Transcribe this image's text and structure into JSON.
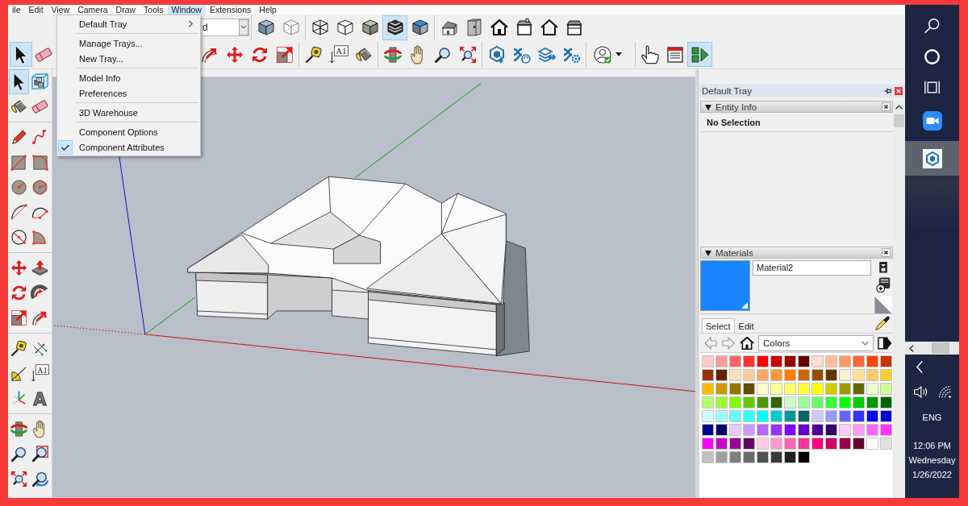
{
  "menu_bar": {
    "items": [
      {
        "label": "ile",
        "selected": false
      },
      {
        "label": "Edit",
        "selected": false
      },
      {
        "label": "View",
        "selected": false
      },
      {
        "label": "Camera",
        "selected": false
      },
      {
        "label": "Draw",
        "selected": false
      },
      {
        "label": "Tools",
        "selected": false
      },
      {
        "label": "Window",
        "selected": true
      },
      {
        "label": "Extensions",
        "selected": false
      },
      {
        "label": "Help",
        "selected": false
      }
    ]
  },
  "window_menu": {
    "groups": [
      [
        {
          "label": "Default Tray",
          "submenu": true,
          "checked": false
        }
      ],
      [
        {
          "label": "Manage Trays...",
          "submenu": false,
          "checked": false
        },
        {
          "label": "New Tray...",
          "submenu": false,
          "checked": false
        }
      ],
      [
        {
          "label": "Model Info",
          "submenu": false,
          "checked": false
        },
        {
          "label": "Preferences",
          "submenu": false,
          "checked": false
        }
      ],
      [
        {
          "label": "3D Warehouse",
          "submenu": false,
          "checked": false
        }
      ],
      [
        {
          "label": "Component Options",
          "submenu": false,
          "checked": false
        },
        {
          "label": "Component Attributes",
          "submenu": false,
          "checked": true
        }
      ]
    ]
  },
  "toolbar_top": {
    "dropdown": {
      "value": "d"
    },
    "groups": [
      [
        {
          "kind": "xray",
          "selected": false
        },
        {
          "kind": "back-edges",
          "selected": false
        }
      ],
      [
        {
          "kind": "wireframe",
          "selected": false
        },
        {
          "kind": "hidden-line",
          "selected": false
        },
        {
          "kind": "shaded",
          "selected": false
        },
        {
          "kind": "textured",
          "selected": true
        },
        {
          "kind": "monochrome",
          "selected": false
        }
      ],
      [
        {
          "kind": "house-iso",
          "selected": false
        },
        {
          "kind": "cabinet",
          "selected": false
        },
        {
          "kind": "house-front",
          "selected": false
        },
        {
          "kind": "house-chimney",
          "selected": false
        },
        {
          "kind": "house-outline",
          "selected": false
        },
        {
          "kind": "house-box",
          "selected": false
        }
      ]
    ]
  },
  "toolbar_main": {
    "groups": [
      [
        {
          "kind": "select",
          "selected": true
        },
        {
          "kind": "eraser",
          "selected": false
        }
      ],
      [
        {
          "kind": "offset",
          "selected": false
        },
        {
          "kind": "move",
          "selected": false
        },
        {
          "kind": "rotate",
          "selected": false
        },
        {
          "kind": "scale",
          "selected": false
        }
      ],
      [
        {
          "kind": "tape",
          "selected": false
        },
        {
          "kind": "text",
          "label": "A1",
          "selected": false
        },
        {
          "kind": "paint",
          "selected": false
        }
      ],
      [
        {
          "kind": "orbit",
          "selected": false
        },
        {
          "kind": "pan",
          "selected": false
        },
        {
          "kind": "zoom",
          "selected": false
        },
        {
          "kind": "zoom-extents",
          "selected": false
        }
      ],
      [
        {
          "kind": "warehouse",
          "selected": false
        },
        {
          "kind": "extension-warehouse",
          "selected": false
        },
        {
          "kind": "layout-send",
          "selected": false
        },
        {
          "kind": "extension-manager",
          "selected": false
        }
      ],
      [
        {
          "kind": "account",
          "selected": false
        }
      ],
      [
        {
          "kind": "pointing-hand",
          "selected": false
        },
        {
          "kind": "panel",
          "selected": false
        },
        {
          "kind": "play",
          "selected": true
        }
      ]
    ]
  },
  "left_toolbar": {
    "groups": [
      [
        {
          "kind": "select",
          "selected": true
        },
        {
          "kind": "component",
          "selected": false
        },
        {
          "kind": "paint",
          "selected": false
        },
        {
          "kind": "eraser",
          "selected": false
        }
      ],
      [
        {
          "kind": "pencil",
          "selected": false
        },
        {
          "kind": "freehand",
          "selected": false
        },
        {
          "kind": "rectangle",
          "selected": false
        },
        {
          "kind": "rotated-rectangle",
          "selected": false
        },
        {
          "kind": "circle",
          "selected": false
        },
        {
          "kind": "polygon",
          "selected": false
        },
        {
          "kind": "arc",
          "selected": false
        },
        {
          "kind": "arc-2pt",
          "selected": false
        },
        {
          "kind": "arc-3pt",
          "selected": false
        },
        {
          "kind": "pie",
          "selected": false
        }
      ],
      [
        {
          "kind": "move",
          "selected": false
        },
        {
          "kind": "push-pull",
          "selected": false
        },
        {
          "kind": "rotate",
          "selected": false
        },
        {
          "kind": "follow-me",
          "selected": false
        },
        {
          "kind": "scale",
          "selected": false
        },
        {
          "kind": "offset",
          "selected": false
        }
      ],
      [
        {
          "kind": "tape",
          "selected": false
        },
        {
          "kind": "dimension",
          "selected": false
        },
        {
          "kind": "protractor",
          "selected": false
        },
        {
          "kind": "text",
          "label": "A1",
          "selected": false
        },
        {
          "kind": "axes",
          "selected": false
        },
        {
          "kind": "text-3d",
          "label": "A",
          "selected": false
        }
      ],
      [
        {
          "kind": "orbit",
          "selected": false
        },
        {
          "kind": "pan",
          "selected": false
        },
        {
          "kind": "zoom",
          "selected": false
        },
        {
          "kind": "zoom-window",
          "selected": false
        },
        {
          "kind": "zoom-extents",
          "selected": false
        },
        {
          "kind": "previous",
          "selected": false
        }
      ]
    ]
  },
  "tray": {
    "title": "Default Tray"
  },
  "entity_info": {
    "title": "Entity Info",
    "expanded": true,
    "selection": "No Selection"
  },
  "materials": {
    "title": "Materials",
    "expanded": true,
    "current": {
      "name": "Material2",
      "color": "#1a84ff"
    },
    "tabs": [
      {
        "label": "Select",
        "selected": true
      },
      {
        "label": "Edit",
        "selected": false
      }
    ],
    "library": "Colors",
    "swatches": [
      {
        "color": "#ffcccc",
        "selected": false
      },
      {
        "color": "#ff9999",
        "selected": false
      },
      {
        "color": "#ff6666",
        "selected": false
      },
      {
        "color": "#ff3333",
        "selected": false
      },
      {
        "color": "#ff0000",
        "selected": false
      },
      {
        "color": "#cc0000",
        "selected": false
      },
      {
        "color": "#990000",
        "selected": false
      },
      {
        "color": "#660000",
        "selected": false
      },
      {
        "color": "#ffddcc",
        "selected": false
      },
      {
        "color": "#ffbb99",
        "selected": false
      },
      {
        "color": "#ff9966",
        "selected": false
      },
      {
        "color": "#ff6633",
        "selected": false
      },
      {
        "color": "#ff4400",
        "selected": false
      },
      {
        "color": "#cc3300",
        "selected": false
      },
      {
        "color": "#993300",
        "selected": false
      },
      {
        "color": "#662200",
        "selected": false
      },
      {
        "color": "#ffe0c0",
        "selected": false
      },
      {
        "color": "#ffcc99",
        "selected": false
      },
      {
        "color": "#ffaa66",
        "selected": false
      },
      {
        "color": "#ff9933",
        "selected": false
      },
      {
        "color": "#ff8000",
        "selected": false
      },
      {
        "color": "#cc6600",
        "selected": false
      },
      {
        "color": "#994c00",
        "selected": false
      },
      {
        "color": "#663300",
        "selected": false
      },
      {
        "color": "#fff0cc",
        "selected": false
      },
      {
        "color": "#ffe099",
        "selected": false
      },
      {
        "color": "#ffcc66",
        "selected": false
      },
      {
        "color": "#ffcc33",
        "selected": false
      },
      {
        "color": "#ffbb00",
        "selected": false
      },
      {
        "color": "#cc9900",
        "selected": false
      },
      {
        "color": "#997300",
        "selected": false
      },
      {
        "color": "#664d00",
        "selected": false
      },
      {
        "color": "#ffffcc",
        "selected": false
      },
      {
        "color": "#ffff99",
        "selected": false
      },
      {
        "color": "#ffff66",
        "selected": false
      },
      {
        "color": "#ffff33",
        "selected": false
      },
      {
        "color": "#ffff00",
        "selected": false
      },
      {
        "color": "#cccc00",
        "selected": false
      },
      {
        "color": "#999900",
        "selected": false
      },
      {
        "color": "#666600",
        "selected": false
      },
      {
        "color": "#eeffcc",
        "selected": false
      },
      {
        "color": "#ccff99",
        "selected": false
      },
      {
        "color": "#b3ff66",
        "selected": false
      },
      {
        "color": "#99ff33",
        "selected": false
      },
      {
        "color": "#80ff00",
        "selected": false
      },
      {
        "color": "#66cc00",
        "selected": false
      },
      {
        "color": "#4d9900",
        "selected": false
      },
      {
        "color": "#336600",
        "selected": false
      },
      {
        "color": "#ccffcc",
        "selected": false
      },
      {
        "color": "#99ff99",
        "selected": false
      },
      {
        "color": "#66ff66",
        "selected": false
      },
      {
        "color": "#33ff33",
        "selected": false
      },
      {
        "color": "#00ff00",
        "selected": false
      },
      {
        "color": "#00cc00",
        "selected": false
      },
      {
        "color": "#009900",
        "selected": false
      },
      {
        "color": "#006600",
        "selected": false
      },
      {
        "color": "#ccffff",
        "selected": false
      },
      {
        "color": "#99ffff",
        "selected": false
      },
      {
        "color": "#66ffff",
        "selected": false
      },
      {
        "color": "#33ffff",
        "selected": false
      },
      {
        "color": "#00ffff",
        "selected": false
      },
      {
        "color": "#00cccc",
        "selected": false
      },
      {
        "color": "#009999",
        "selected": false
      },
      {
        "color": "#006666",
        "selected": false
      },
      {
        "color": "#ccccff",
        "selected": false
      },
      {
        "color": "#9999ff",
        "selected": false
      },
      {
        "color": "#6666ff",
        "selected": false
      },
      {
        "color": "#3333ff",
        "selected": false
      },
      {
        "color": "#0000ff",
        "selected": false
      },
      {
        "color": "#0000cc",
        "selected": false
      },
      {
        "color": "#000099",
        "selected": false
      },
      {
        "color": "#000066",
        "selected": false
      },
      {
        "color": "#e5ccff",
        "selected": false
      },
      {
        "color": "#cc99ff",
        "selected": false
      },
      {
        "color": "#b266ff",
        "selected": false
      },
      {
        "color": "#9933ff",
        "selected": false
      },
      {
        "color": "#8000ff",
        "selected": false
      },
      {
        "color": "#6600cc",
        "selected": false
      },
      {
        "color": "#4c0099",
        "selected": false
      },
      {
        "color": "#330066",
        "selected": false
      },
      {
        "color": "#ffccff",
        "selected": false
      },
      {
        "color": "#ff99ff",
        "selected": false
      },
      {
        "color": "#ff66ff",
        "selected": false
      },
      {
        "color": "#ff33ff",
        "selected": false
      },
      {
        "color": "#ff00ff",
        "selected": false
      },
      {
        "color": "#cc00cc",
        "selected": false
      },
      {
        "color": "#990099",
        "selected": false
      },
      {
        "color": "#660066",
        "selected": false
      },
      {
        "color": "#ffcce5",
        "selected": false
      },
      {
        "color": "#ff99cc",
        "selected": false
      },
      {
        "color": "#ff66b2",
        "selected": false
      },
      {
        "color": "#ff3399",
        "selected": false
      },
      {
        "color": "#ff0080",
        "selected": false
      },
      {
        "color": "#cc0066",
        "selected": false
      },
      {
        "color": "#99004c",
        "selected": false
      },
      {
        "color": "#660033",
        "selected": false
      },
      {
        "color": "#ffffff",
        "selected": false
      },
      {
        "color": "#e0e0e0",
        "selected": false
      },
      {
        "color": "#c0c0c0",
        "selected": false
      },
      {
        "color": "#a0a0a0",
        "selected": false
      },
      {
        "color": "#808080",
        "selected": false
      },
      {
        "color": "#6b6b6b",
        "selected": false
      },
      {
        "color": "#505050",
        "selected": false
      },
      {
        "color": "#3a3a3a",
        "selected": false
      },
      {
        "color": "#202020",
        "selected": false
      },
      {
        "color": "#000000",
        "selected": false
      }
    ]
  },
  "taskbar": {
    "apps": [
      {
        "kind": "video-call",
        "selected": false
      },
      {
        "kind": "sketchup",
        "selected": true
      }
    ],
    "language": "ENG",
    "time": "12:06 PM",
    "day": "Wednesday",
    "date": "1/26/2022"
  }
}
